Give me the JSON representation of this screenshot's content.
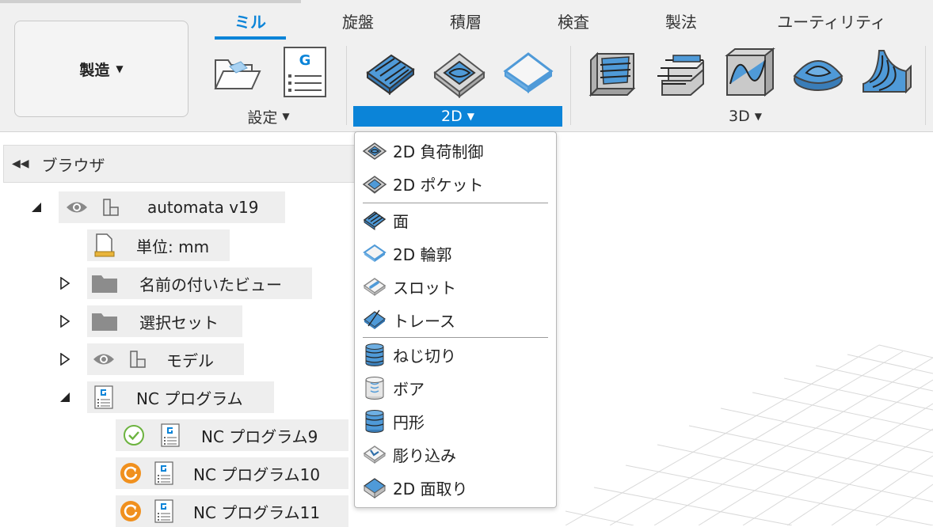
{
  "workspace": {
    "label": "製造"
  },
  "tabs": [
    {
      "label": "ミル",
      "active": true
    },
    {
      "label": "旋盤"
    },
    {
      "label": "積層"
    },
    {
      "label": "検査"
    },
    {
      "label": "製法"
    },
    {
      "label": "ユーティリティ"
    }
  ],
  "groups": {
    "setup": "設定",
    "g2d": "2D",
    "g3d": "3D"
  },
  "toolbar_icons": {
    "nc_program_glyph": "G"
  },
  "browser": {
    "title": "ブラウザ",
    "root": "automata v19",
    "units": "単位: mm",
    "named_views": "名前の付いたビュー",
    "selection_sets": "選択セット",
    "model": "モデル",
    "nc_programs": "NC プログラム",
    "programs": [
      "NC プログラム9",
      "NC プログラム10",
      "NC プログラム11"
    ]
  },
  "menu_2d": {
    "items": [
      "2D 負荷制御",
      "2D ポケット",
      "面",
      "2D 輪郭",
      "スロット",
      "トレース",
      "ねじ切り",
      "ボア",
      "円形",
      "彫り込み",
      "2D 面取り"
    ]
  },
  "colors": {
    "accent": "#0b84d8",
    "ok_status": "#6cb33f",
    "warn_status": "#f0901e"
  }
}
